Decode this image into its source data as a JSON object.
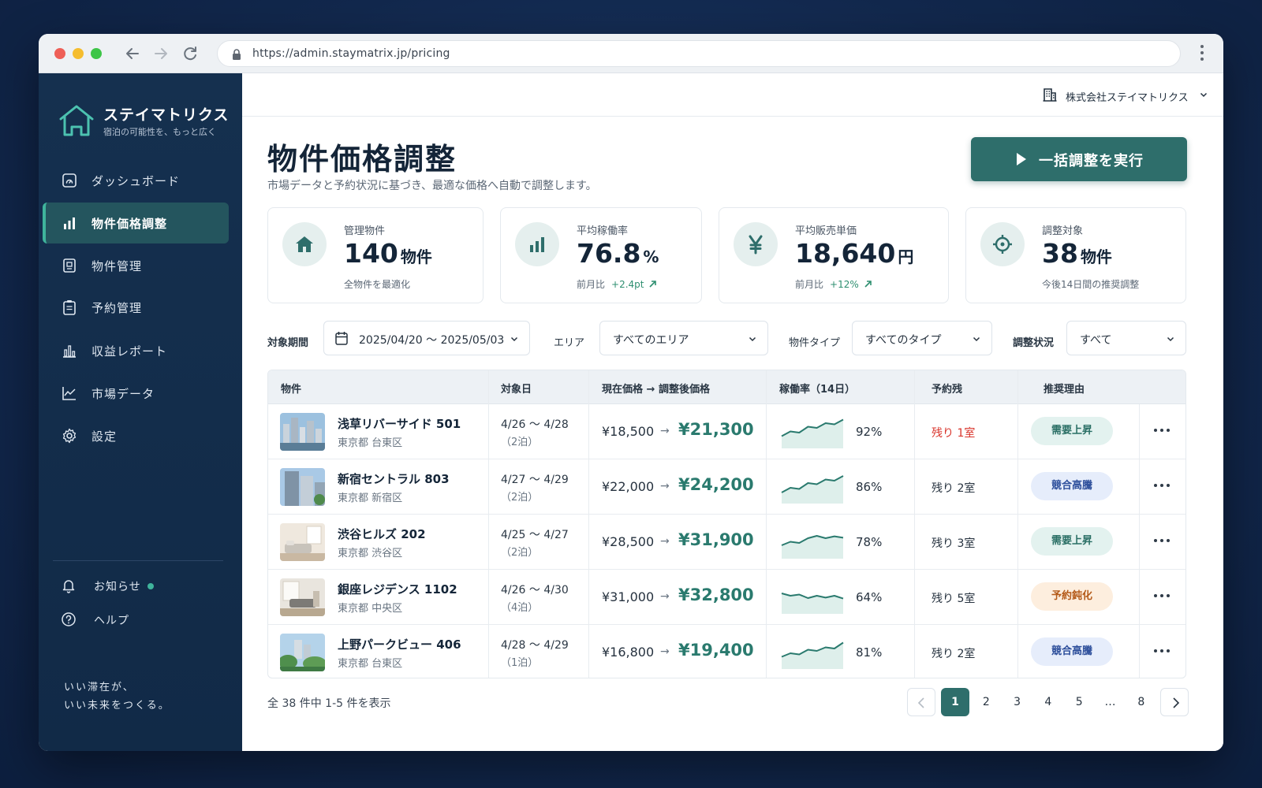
{
  "browser": {
    "url": "https://admin.staymatrix.jp/pricing"
  },
  "sidebar": {
    "brand": {
      "name": "ステイマトリクス",
      "tagline": "宿泊の可能性を、もっと広く"
    },
    "items": [
      {
        "label": "ダッシュボード",
        "icon": "dashboard-icon",
        "active": false
      },
      {
        "label": "物件価格調整",
        "icon": "bar-chart-icon",
        "active": true
      },
      {
        "label": "物件管理",
        "icon": "building-doc-icon",
        "active": false
      },
      {
        "label": "予約管理",
        "icon": "clipboard-icon",
        "active": false
      },
      {
        "label": "収益レポート",
        "icon": "report-bars-icon",
        "active": false
      },
      {
        "label": "市場データ",
        "icon": "line-chart-icon",
        "active": false
      },
      {
        "label": "設定",
        "icon": "gear-icon",
        "active": false
      }
    ],
    "notifications_label": "お知らせ",
    "help_label": "ヘルプ",
    "slogan_line1": "いい滞在が、",
    "slogan_line2": "いい未来をつくる。"
  },
  "header": {
    "company": "株式会社ステイマトリクス"
  },
  "page": {
    "title": "物件価格調整",
    "subtitle": "市場データと予約状況に基づき、最適な価格へ自動で調整します。",
    "run_button": "一括調整を実行"
  },
  "kpis": [
    {
      "label": "管理物件",
      "value": "140",
      "unit": "物件",
      "sub": "全物件を最適化",
      "delta": "",
      "icon": "home-icon"
    },
    {
      "label": "平均稼働率",
      "value": "76.8",
      "unit": "%",
      "sub": "前月比",
      "delta": "+2.4pt",
      "icon": "bar-chart-icon"
    },
    {
      "label": "平均販売単価",
      "value": "18,640",
      "unit": "円",
      "sub": "前月比",
      "delta": "+12%",
      "icon": "yen-icon"
    },
    {
      "label": "調整対象",
      "value": "38",
      "unit": "物件",
      "sub": "今後14日間の推奨調整",
      "delta": "",
      "icon": "target-icon"
    }
  ],
  "filters": {
    "period_label": "対象期間",
    "period_value": "2025/04/20 〜 2025/05/03",
    "area_label": "エリア",
    "area_value": "すべてのエリア",
    "type_label": "物件タイプ",
    "type_value": "すべてのタイプ",
    "status_label": "調整状況",
    "status_value": "すべて"
  },
  "table": {
    "headers": {
      "property": "物件",
      "date": "対象日",
      "price": "現在価格 → 調整後価格",
      "occupancy": "稼働率（14日）",
      "remaining": "予約残",
      "reason": "推奨理由"
    },
    "rows": [
      {
        "name": "浅草リバーサイド 501",
        "area": "東京都 台東区",
        "dates": "4/26 〜 4/28",
        "nights": "（2泊）",
        "current": "¥18,500",
        "adjusted": "¥21,300",
        "occupancy": "92%",
        "trend": [
          0.25,
          0.45,
          0.4,
          0.65,
          0.6,
          0.8,
          0.75,
          0.95
        ],
        "remaining": "残り 1室",
        "urgent": true,
        "reason": "需要上昇",
        "reason_color": "teal"
      },
      {
        "name": "新宿セントラル 803",
        "area": "東京都 新宿区",
        "dates": "4/27 〜 4/29",
        "nights": "（2泊）",
        "current": "¥22,000",
        "adjusted": "¥24,200",
        "occupancy": "86%",
        "trend": [
          0.2,
          0.4,
          0.35,
          0.6,
          0.55,
          0.75,
          0.7,
          0.9
        ],
        "remaining": "残り 2室",
        "urgent": false,
        "reason": "競合高騰",
        "reason_color": "blue"
      },
      {
        "name": "渋谷ヒルズ 202",
        "area": "東京都 渋谷区",
        "dates": "4/25 〜 4/27",
        "nights": "（2泊）",
        "current": "¥28,500",
        "adjusted": "¥31,900",
        "occupancy": "78%",
        "trend": [
          0.3,
          0.45,
          0.4,
          0.6,
          0.7,
          0.6,
          0.68,
          0.62
        ],
        "remaining": "残り 3室",
        "urgent": false,
        "reason": "需要上昇",
        "reason_color": "teal"
      },
      {
        "name": "銀座レジデンス 1102",
        "area": "東京都 中央区",
        "dates": "4/26 〜 4/30",
        "nights": "（4泊）",
        "current": "¥31,000",
        "adjusted": "¥32,800",
        "occupancy": "64%",
        "trend": [
          0.6,
          0.5,
          0.55,
          0.4,
          0.5,
          0.42,
          0.5,
          0.38
        ],
        "remaining": "残り 5室",
        "urgent": false,
        "reason": "予約鈍化",
        "reason_color": "orange"
      },
      {
        "name": "上野パークビュー 406",
        "area": "東京都 台東区",
        "dates": "4/28 〜 4/29",
        "nights": "（1泊）",
        "current": "¥16,800",
        "adjusted": "¥19,400",
        "occupancy": "81%",
        "trend": [
          0.25,
          0.4,
          0.35,
          0.55,
          0.5,
          0.65,
          0.6,
          0.85
        ],
        "remaining": "残り 2室",
        "urgent": false,
        "reason": "競合高騰",
        "reason_color": "blue"
      }
    ]
  },
  "footer": {
    "count_text": "全 38 件中 1-5 件を表示",
    "pages": [
      "1",
      "2",
      "3",
      "4",
      "5",
      "…",
      "8"
    ],
    "current_page": "1"
  },
  "colors": {
    "accent": "#2e6e6b",
    "sidebar_bg": "#15304f",
    "positive": "#2e8f70",
    "urgent": "#d9342b"
  }
}
